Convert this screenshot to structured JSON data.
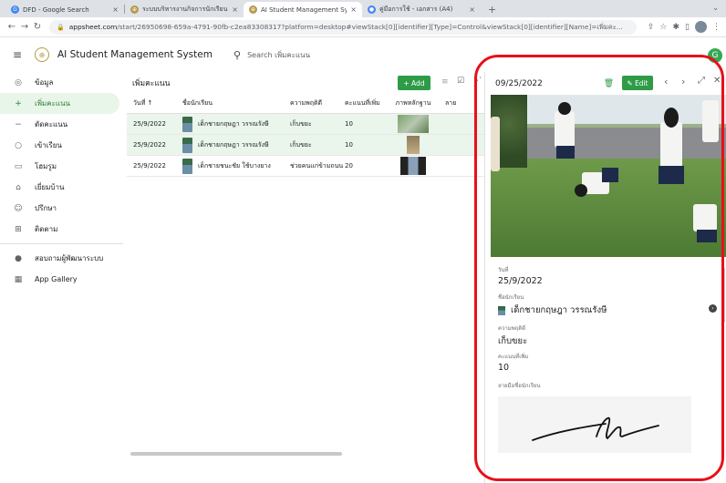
{
  "browser": {
    "tabs": [
      {
        "title": "DFD - Google Search",
        "favicon": "G",
        "favicon_color": "#4285f4"
      },
      {
        "title": "ระบบบริหารงานกิจการนักเรียน อง",
        "favicon": "⊕",
        "favicon_color": "#b59b4a"
      },
      {
        "title": "AI Student Management Syste",
        "favicon": "⊕",
        "favicon_color": "#b59b4a",
        "active": true
      },
      {
        "title": "คู่มือการใช้ - เอกสาร (A4)",
        "favicon": "●",
        "favicon_color": "#4285f4"
      }
    ],
    "url_host": "appsheet.com",
    "url_path": "/start/26950698-659a-4791-90fb-c2ea83308317?platform=desktop#viewStack[0][identifier][Type]=Control&viewStack[0][identifier][Name]=เพิ่มคะ..."
  },
  "app": {
    "title": "AI Student Management System",
    "search_placeholder": "Search เพิ่มคะแนน",
    "user_initial": "G",
    "accent_color": "#2e9b47"
  },
  "sidebar": {
    "items": [
      {
        "label": "ข้อมูล",
        "icon": "person-outline-icon",
        "glyph": "◎"
      },
      {
        "label": "เพิ่มคะแนน",
        "icon": "person-add-icon",
        "glyph": "+",
        "active": true
      },
      {
        "label": "ตัดคะแนน",
        "icon": "person-remove-icon",
        "glyph": "−"
      },
      {
        "label": "เข้าเรียน",
        "icon": "person-check-icon",
        "glyph": "○"
      },
      {
        "label": "โฮมรูม",
        "icon": "classroom-icon",
        "glyph": "▭"
      },
      {
        "label": "เยี่ยมบ้าน",
        "icon": "home-visit-icon",
        "glyph": "⌂"
      },
      {
        "label": "ปรึกษา",
        "icon": "consult-icon",
        "glyph": "☺"
      },
      {
        "label": "ติดตาม",
        "icon": "follow-up-icon",
        "glyph": "⊞"
      }
    ],
    "footer_items": [
      {
        "label": "สอบถามผู้พัฒนาระบบ",
        "icon": "info-icon",
        "glyph": "●"
      },
      {
        "label": "App Gallery",
        "icon": "grid-icon",
        "glyph": "▦"
      }
    ]
  },
  "table": {
    "title": "เพิ่มคะแนน",
    "add_label": "+ Add",
    "columns": [
      "วันที่ ↑",
      "ชื่อนักเรียน",
      "ความพฤติดี",
      "คะแนนที่เพิ่ม",
      "ภาพหลักฐาน",
      "ลาย"
    ],
    "rows": [
      {
        "date": "25/9/2022",
        "name": "เด็กชายกฤษฎา วรรณรังษี",
        "behavior": "เก็บขยะ",
        "score": "10",
        "selected": true
      },
      {
        "date": "25/9/2022",
        "name": "เด็กชายกฤษฎา วรรณรังษี",
        "behavior": "เก็บขยะ",
        "score": "10",
        "selected": true
      },
      {
        "date": "25/9/2022",
        "name": "เด็กชายชนะชัย ใช้บางยาง",
        "behavior": "ช่วยคนแก่ข้ามถนน",
        "score": "20",
        "selected": false
      }
    ]
  },
  "detail": {
    "header_date": "09/25/2022",
    "edit_label": "Edit",
    "fields": {
      "date_label": "วันที่",
      "date_value": "25/9/2022",
      "student_label": "ชื่อนักเรียน",
      "student_value": "เด็กชายกฤษฎา  วรรณรังษี",
      "behavior_label": "ความพฤติดี",
      "behavior_value": "เก็บขยะ",
      "score_label": "คะแนนที่เพิ่ม",
      "score_value": "10",
      "signature_label": "ลายมือชื่อนักเรียน"
    }
  }
}
